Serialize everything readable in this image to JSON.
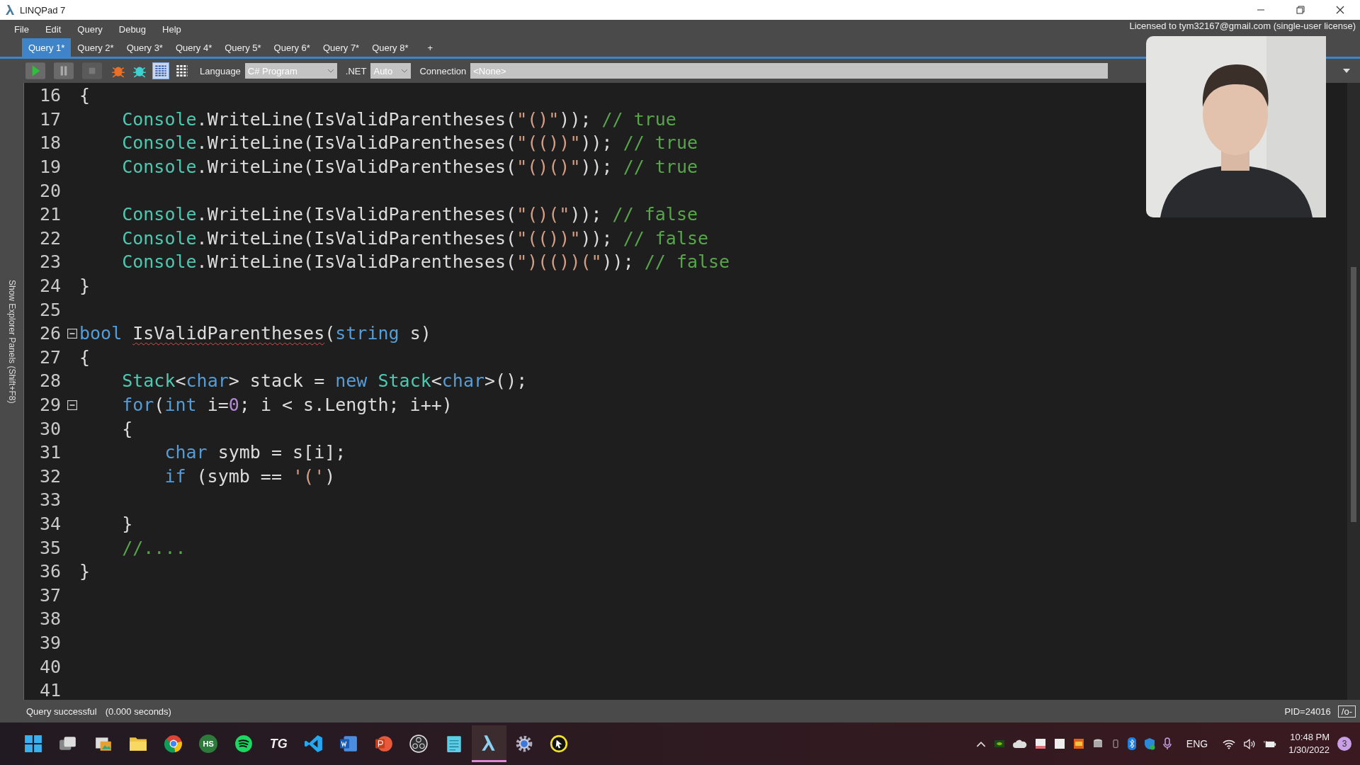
{
  "window": {
    "title": "LINQPad 7"
  },
  "menu": [
    "File",
    "Edit",
    "Query",
    "Debug",
    "Help"
  ],
  "license": "Licensed to tym32167@gmail.com (single-user license)",
  "tabs": [
    {
      "label": "Query 1*",
      "selected": true
    },
    {
      "label": "Query 2*",
      "selected": false
    },
    {
      "label": "Query 3*",
      "selected": false
    },
    {
      "label": "Query 4*",
      "selected": false
    },
    {
      "label": "Query 5*",
      "selected": false
    },
    {
      "label": "Query 6*",
      "selected": false
    },
    {
      "label": "Query 7*",
      "selected": false
    },
    {
      "label": "Query 8*",
      "selected": false
    }
  ],
  "new_tab": "+",
  "toolbar": {
    "language_label": "Language",
    "language": "C# Program",
    "net_label": ".NET",
    "net": "Auto",
    "connection_label": "Connection",
    "connection": "<None>"
  },
  "side_panel": "Show Explorer Panels (Shift+F8)",
  "editor": {
    "lines": [
      {
        "number": "16",
        "fold": false,
        "tokens": [
          {
            "kind": "plain",
            "text": "{"
          }
        ]
      },
      {
        "number": "17",
        "fold": false,
        "tokens": [
          {
            "kind": "type",
            "text": "    Console"
          },
          {
            "kind": "plain",
            "text": ".WriteLine(IsValidParentheses("
          },
          {
            "kind": "str",
            "text": "\"()\""
          },
          {
            "kind": "plain",
            "text": ")); "
          },
          {
            "kind": "com",
            "text": "// true"
          }
        ]
      },
      {
        "number": "18",
        "fold": false,
        "tokens": [
          {
            "kind": "type",
            "text": "    Console"
          },
          {
            "kind": "plain",
            "text": ".WriteLine(IsValidParentheses("
          },
          {
            "kind": "str",
            "text": "\"(())\""
          },
          {
            "kind": "plain",
            "text": ")); "
          },
          {
            "kind": "com",
            "text": "// true"
          }
        ]
      },
      {
        "number": "19",
        "fold": false,
        "tokens": [
          {
            "kind": "type",
            "text": "    Console"
          },
          {
            "kind": "plain",
            "text": ".WriteLine(IsValidParentheses("
          },
          {
            "kind": "str",
            "text": "\"()()\""
          },
          {
            "kind": "plain",
            "text": ")); "
          },
          {
            "kind": "com",
            "text": "// true"
          }
        ]
      },
      {
        "number": "20",
        "fold": false
      },
      {
        "number": "21",
        "fold": false,
        "tokens": [
          {
            "kind": "type",
            "text": "    Console"
          },
          {
            "kind": "plain",
            "text": ".WriteLine(IsValidParentheses("
          },
          {
            "kind": "str",
            "text": "\"()(\""
          },
          {
            "kind": "plain",
            "text": ")); "
          },
          {
            "kind": "com",
            "text": "// false"
          }
        ]
      },
      {
        "number": "22",
        "fold": false,
        "tokens": [
          {
            "kind": "type",
            "text": "    Console"
          },
          {
            "kind": "plain",
            "text": ".WriteLine(IsValidParentheses("
          },
          {
            "kind": "str",
            "text": "\"(())\""
          },
          {
            "kind": "plain",
            "text": ")); "
          },
          {
            "kind": "com",
            "text": "// false"
          }
        ]
      },
      {
        "number": "23",
        "fold": false,
        "tokens": [
          {
            "kind": "type",
            "text": "    Console"
          },
          {
            "kind": "plain",
            "text": ".WriteLine(IsValidParentheses("
          },
          {
            "kind": "str",
            "text": "\")(())(\""
          },
          {
            "kind": "plain",
            "text": ")); "
          },
          {
            "kind": "com",
            "text": "// false"
          }
        ]
      },
      {
        "number": "24",
        "fold": false,
        "tokens": [
          {
            "kind": "plain",
            "text": "}"
          }
        ]
      },
      {
        "number": "25",
        "fold": false
      },
      {
        "number": "26",
        "fold": true,
        "tokens": [
          {
            "kind": "kw",
            "text": "bool "
          },
          {
            "kind": "err",
            "text": "IsValidParentheses"
          },
          {
            "kind": "plain",
            "text": "("
          },
          {
            "kind": "kw",
            "text": "string"
          },
          {
            "kind": "plain",
            "text": " s)"
          }
        ]
      },
      {
        "number": "27",
        "fold": false,
        "tokens": [
          {
            "kind": "plain",
            "text": "{"
          }
        ]
      },
      {
        "number": "28",
        "fold": false,
        "tokens": [
          {
            "kind": "type",
            "text": "    Stack"
          },
          {
            "kind": "plain",
            "text": "<"
          },
          {
            "kind": "kw",
            "text": "char"
          },
          {
            "kind": "plain",
            "text": "> stack = "
          },
          {
            "kind": "kw",
            "text": "new "
          },
          {
            "kind": "type",
            "text": "Stack"
          },
          {
            "kind": "plain",
            "text": "<"
          },
          {
            "kind": "kw",
            "text": "char"
          },
          {
            "kind": "plain",
            "text": ">();"
          }
        ]
      },
      {
        "number": "29",
        "fold": true,
        "tokens": [
          {
            "kind": "kw",
            "text": "    for"
          },
          {
            "kind": "plain",
            "text": "("
          },
          {
            "kind": "kw",
            "text": "int"
          },
          {
            "kind": "plain",
            "text": " i="
          },
          {
            "kind": "num",
            "text": "0"
          },
          {
            "kind": "plain",
            "text": "; i < s.Length; i++)"
          }
        ]
      },
      {
        "number": "30",
        "fold": false,
        "tokens": [
          {
            "kind": "plain",
            "text": "    {"
          }
        ]
      },
      {
        "number": "31",
        "fold": false,
        "tokens": [
          {
            "kind": "kw",
            "text": "        char"
          },
          {
            "kind": "plain",
            "text": " symb = s[i];"
          }
        ]
      },
      {
        "number": "32",
        "fold": false,
        "tokens": [
          {
            "kind": "kw",
            "text": "        if"
          },
          {
            "kind": "plain",
            "text": " (symb == "
          },
          {
            "kind": "str",
            "text": "'('"
          },
          {
            "kind": "plain",
            "text": ")"
          }
        ]
      },
      {
        "number": "33",
        "fold": false
      },
      {
        "number": "34",
        "fold": false,
        "tokens": [
          {
            "kind": "plain",
            "text": "    }"
          }
        ]
      },
      {
        "number": "35",
        "fold": false,
        "tokens": [
          {
            "kind": "com",
            "text": "    //...."
          }
        ]
      },
      {
        "number": "36",
        "fold": false,
        "tokens": [
          {
            "kind": "plain",
            "text": "}"
          }
        ]
      },
      {
        "number": "37",
        "fold": false
      },
      {
        "number": "38",
        "fold": false
      },
      {
        "number": "39",
        "fold": false
      },
      {
        "number": "40",
        "fold": false
      },
      {
        "number": "41",
        "fold": false
      }
    ]
  },
  "webcam": {
    "kind": "picture"
  },
  "status_bar": {
    "message": "Query successful",
    "time": "(0.000 seconds)",
    "pid": "PID=24016",
    "mode": "/o-"
  },
  "taskbar": {
    "apps": [
      {
        "kind": "start",
        "active": false
      },
      {
        "kind": "windows",
        "active": false
      },
      {
        "kind": "photos",
        "active": false
      },
      {
        "kind": "folder",
        "active": false
      },
      {
        "kind": "browser",
        "active": false
      },
      {
        "kind": "badge",
        "label": "HS",
        "active": false
      },
      {
        "kind": "music",
        "active": false
      },
      {
        "kind": "mono",
        "label": "TG",
        "active": false
      },
      {
        "kind": "code",
        "active": false
      },
      {
        "kind": "doc",
        "active": false
      },
      {
        "kind": "slides",
        "active": false
      },
      {
        "kind": "record",
        "active": false
      },
      {
        "kind": "notes",
        "active": false
      },
      {
        "kind": "lambda",
        "active": true
      },
      {
        "kind": "gear",
        "active": false
      },
      {
        "kind": "pointer",
        "active": false
      }
    ],
    "language": "ENG",
    "time": "10:48 PM",
    "date": "1/30/2022",
    "notifications": "3"
  }
}
